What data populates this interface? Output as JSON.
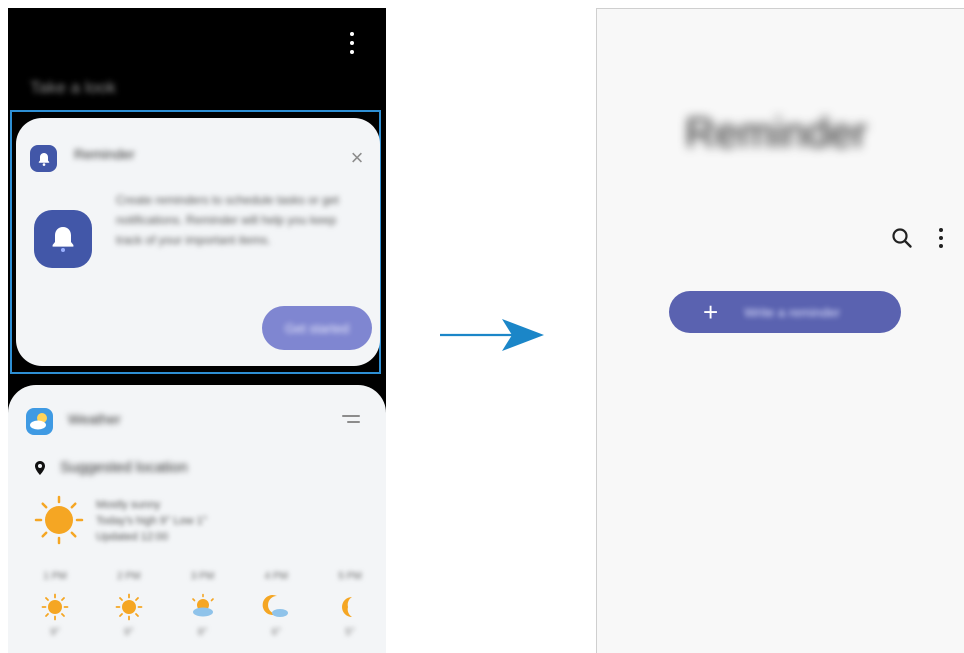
{
  "left_panel": {
    "title": "Take a look",
    "reminder_card": {
      "app_name": "Reminder",
      "description": "Create reminders to schedule tasks or get notifications. Reminder will help you keep track of your important items.",
      "action_label": "Get started"
    },
    "weather_card": {
      "app_name": "Weather",
      "location": "Suggested location",
      "details": [
        "Mostly sunny",
        "Today's high 9° Low 1°",
        "Updated 12:00"
      ],
      "forecast": [
        {
          "time": "1 PM",
          "icon": "sun-icon",
          "temp": "9°"
        },
        {
          "time": "2 PM",
          "icon": "sun-icon",
          "temp": "9°"
        },
        {
          "time": "3 PM",
          "icon": "partly-cloudy-icon",
          "temp": "8°"
        },
        {
          "time": "4 PM",
          "icon": "moon-cloud-icon",
          "temp": "6°"
        },
        {
          "time": "5 PM",
          "icon": "moon-icon",
          "temp": "5°"
        }
      ]
    }
  },
  "right_panel": {
    "title": "Reminder",
    "add_button_label": "Write a reminder"
  },
  "colors": {
    "accent": "#4257a8",
    "button": "#5a62b0",
    "highlight": "#2e8fd4",
    "arrow": "#1b86c8",
    "sun": "#f5a623"
  }
}
